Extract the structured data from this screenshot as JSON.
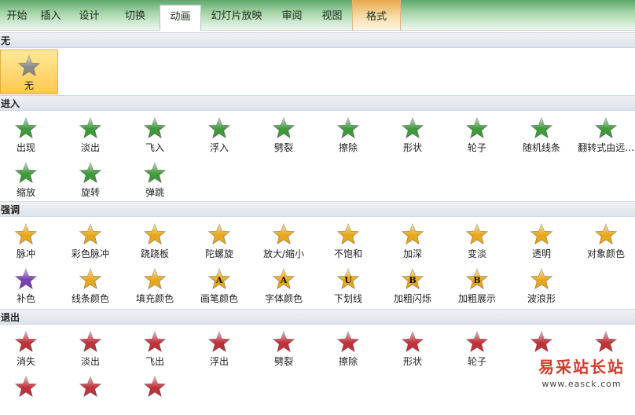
{
  "tabs": [
    {
      "label": "开始",
      "state": "normal"
    },
    {
      "label": "插入",
      "state": "normal"
    },
    {
      "label": "设计",
      "state": "normal"
    },
    {
      "label": "切换",
      "state": "normal"
    },
    {
      "label": "动画",
      "state": "active"
    },
    {
      "label": "幻灯片放映",
      "state": "normal"
    },
    {
      "label": "审阅",
      "state": "normal"
    },
    {
      "label": "视图",
      "state": "normal"
    },
    {
      "label": "格式",
      "state": "context"
    }
  ],
  "colors": {
    "none": "#8a8a8a",
    "entrance": "#3f9a3c",
    "emphasis": "#e8a81c",
    "exit": "#c0323a",
    "selection": "#ffc94e"
  },
  "sections": [
    {
      "key": "none",
      "title": "无",
      "rows": [
        [
          {
            "label": "无",
            "icon": "star-gray-icon",
            "selected": true
          }
        ]
      ]
    },
    {
      "key": "entrance",
      "title": "进入",
      "rows": [
        [
          {
            "label": "出现",
            "icon": "star-green-icon"
          },
          {
            "label": "淡出",
            "icon": "star-green-fade-icon"
          },
          {
            "label": "飞入",
            "icon": "star-green-fly-icon"
          },
          {
            "label": "浮入",
            "icon": "star-green-float-icon"
          },
          {
            "label": "劈裂",
            "icon": "star-green-split-icon"
          },
          {
            "label": "擦除",
            "icon": "star-green-wipe-icon"
          },
          {
            "label": "形状",
            "icon": "star-green-shape-icon"
          },
          {
            "label": "轮子",
            "icon": "star-green-wheel-icon"
          },
          {
            "label": "随机线条",
            "icon": "star-green-lines-icon"
          },
          {
            "label": "翻转式由远...",
            "icon": "star-green-flip-icon"
          }
        ],
        [
          {
            "label": "缩放",
            "icon": "star-green-zoom-icon"
          },
          {
            "label": "旋转",
            "icon": "star-green-rotate-icon"
          },
          {
            "label": "弹跳",
            "icon": "star-green-bounce-icon"
          }
        ]
      ]
    },
    {
      "key": "emphasis",
      "title": "强调",
      "rows": [
        [
          {
            "label": "脉冲",
            "icon": "star-gold-pulse-icon"
          },
          {
            "label": "彩色脉冲",
            "icon": "star-gold-color-pulse-icon"
          },
          {
            "label": "跷跷板",
            "icon": "star-gold-teeter-icon"
          },
          {
            "label": "陀螺旋",
            "icon": "star-gold-spin-icon"
          },
          {
            "label": "放大/缩小",
            "icon": "star-gold-grow-icon"
          },
          {
            "label": "不饱和",
            "icon": "star-gold-desaturate-icon"
          },
          {
            "label": "加深",
            "icon": "star-gold-darken-icon"
          },
          {
            "label": "变淡",
            "icon": "star-gold-lighten-icon"
          },
          {
            "label": "透明",
            "icon": "star-gold-transparency-icon"
          },
          {
            "label": "对象颜色",
            "icon": "star-gold-object-color-icon"
          }
        ],
        [
          {
            "label": "补色",
            "icon": "star-purple-complement-icon"
          },
          {
            "label": "线条颜色",
            "icon": "star-gold-line-color-icon"
          },
          {
            "label": "填充颜色",
            "icon": "star-gold-fill-color-icon"
          },
          {
            "label": "画笔颜色",
            "icon": "star-gold-brush-color-icon",
            "letter": "A"
          },
          {
            "label": "字体颜色",
            "icon": "star-gold-font-color-icon",
            "letter": "A"
          },
          {
            "label": "下划线",
            "icon": "star-gold-underline-icon",
            "letter": "U"
          },
          {
            "label": "加粗闪烁",
            "icon": "star-gold-bold-flash-icon",
            "letter": "B"
          },
          {
            "label": "加粗展示",
            "icon": "star-gold-bold-reveal-icon",
            "letter": "B"
          },
          {
            "label": "波浪形",
            "icon": "star-gold-wave-icon"
          }
        ]
      ]
    },
    {
      "key": "exit",
      "title": "退出",
      "rows": [
        [
          {
            "label": "消失",
            "icon": "star-red-disappear-icon"
          },
          {
            "label": "淡出",
            "icon": "star-red-fade-icon"
          },
          {
            "label": "飞出",
            "icon": "star-red-fly-out-icon"
          },
          {
            "label": "浮出",
            "icon": "star-red-float-out-icon"
          },
          {
            "label": "劈裂",
            "icon": "star-red-split-icon"
          },
          {
            "label": "擦除",
            "icon": "star-red-wipe-icon"
          },
          {
            "label": "形状",
            "icon": "star-red-shape-icon"
          },
          {
            "label": "轮子",
            "icon": "star-red-wheel-icon"
          },
          {
            "label": "",
            "icon": "star-red-lines-icon"
          },
          {
            "label": "",
            "icon": "star-red-flip-icon"
          }
        ],
        [
          {
            "label": "",
            "icon": "star-red-zoom-icon"
          },
          {
            "label": "",
            "icon": "star-red-rotate-icon"
          },
          {
            "label": "",
            "icon": "star-red-bounce-icon"
          }
        ]
      ]
    }
  ],
  "watermark": {
    "main": "易采站长站",
    "url": "www.easck.com"
  }
}
